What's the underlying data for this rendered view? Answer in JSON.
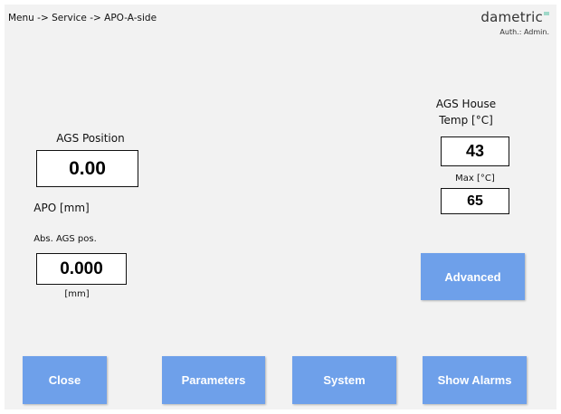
{
  "header": {
    "breadcrumb": "Menu -> Service -> APO-A-side",
    "brand": "dametric",
    "auth": "Auth.: Admin."
  },
  "position": {
    "title": "AGS Position",
    "value": "0.00",
    "unit_label": "APO [mm]"
  },
  "abs_position": {
    "title": "Abs. AGS pos.",
    "value": "0.000",
    "unit_label": "[mm]"
  },
  "house_temp": {
    "title_line1": "AGS House",
    "title_line2": "Temp [°C]",
    "value": "43",
    "max_label": "Max [°C]",
    "max_value": "65"
  },
  "buttons": {
    "advanced": "Advanced",
    "close": "Close",
    "parameters": "Parameters",
    "system": "System",
    "show_alarms": "Show Alarms"
  },
  "colors": {
    "button": "#6ea0ea",
    "background": "#f2f2f2",
    "brand_accent": "#9fd8c8"
  }
}
